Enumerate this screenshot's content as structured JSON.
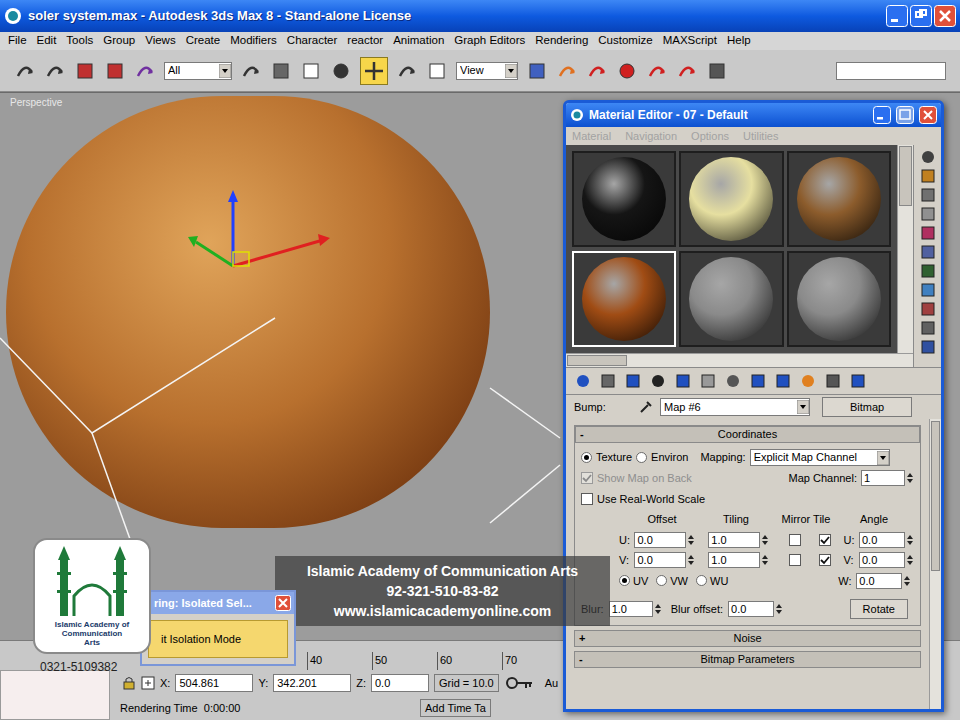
{
  "window": {
    "title": "soler system.max - Autodesk 3ds Max 8 - Stand-alone License"
  },
  "menu": [
    "File",
    "Edit",
    "Tools",
    "Group",
    "Views",
    "Create",
    "Modifiers",
    "Character",
    "reactor",
    "Animation",
    "Graph Editors",
    "Rendering",
    "Customize",
    "MAXScript",
    "Help"
  ],
  "toolbar": {
    "selection_filter": "All",
    "reference_coord": "View"
  },
  "viewport": {
    "label": "Perspective"
  },
  "material_editor": {
    "title": "Material Editor - 07 - Default",
    "menu": [
      {
        "label": "Material",
        "disabled": true
      },
      {
        "label": "Navigation",
        "disabled": true
      },
      {
        "label": "Options",
        "disabled": true
      },
      {
        "label": "Utilities",
        "disabled": true
      }
    ],
    "slots": [
      {
        "selected": false,
        "color": "#151515"
      },
      {
        "selected": false,
        "color": "#e6dfa0"
      },
      {
        "selected": false,
        "color": "#8c5c2c"
      },
      {
        "selected": true,
        "color": "#a04c14"
      },
      {
        "selected": false,
        "color": "#8a8a8a"
      },
      {
        "selected": false,
        "color": "#8a8a8a"
      }
    ],
    "bump": {
      "label": "Bump:",
      "map": "Map #6",
      "type": "Bitmap"
    },
    "coordinates": {
      "title": "Coordinates",
      "toggle": "-",
      "modes": [
        {
          "label": "Texture",
          "selected": true
        },
        {
          "label": "Environ",
          "selected": false
        }
      ],
      "mapping_label": "Mapping:",
      "mapping": "Explicit Map Channel",
      "show_map_on_back": {
        "label": "Show Map on Back",
        "checked": true,
        "disabled": true
      },
      "map_channel_label": "Map Channel:",
      "map_channel": "1",
      "real_world": {
        "label": "Use Real-World Scale",
        "checked": false
      },
      "headers": [
        "Offset",
        "Tiling",
        "Mirror Tile",
        "Angle"
      ],
      "rows": [
        {
          "axis": "U:",
          "offset": "0.0",
          "tiling": "1.0",
          "mirror": false,
          "tile": true,
          "angle_axis": "U:",
          "angle": "0.0"
        },
        {
          "axis": "V:",
          "offset": "0.0",
          "tiling": "1.0",
          "mirror": false,
          "tile": true,
          "angle_axis": "V:",
          "angle": "0.0"
        }
      ],
      "planes": [
        {
          "label": "UV",
          "selected": true
        },
        {
          "label": "VW",
          "selected": false
        },
        {
          "label": "WU",
          "selected": false
        }
      ],
      "w_axis": "W:",
      "w_angle": "0.0",
      "blur_label": "Blur:",
      "blur": "1.0",
      "blur_offset_label": "Blur offset:",
      "blur_offset": "0.0",
      "rotate": "Rotate"
    },
    "rollouts": [
      {
        "title": "Noise",
        "toggle": "+"
      },
      {
        "title": "Bitmap Parameters",
        "toggle": "-"
      }
    ]
  },
  "watermark": [
    "Islamic Academy of Communication Arts",
    "92-321-510-83-82",
    "www.islamicacademyonline.com"
  ],
  "logo": {
    "text": "Islamic Academy of Communication Arts",
    "phone": "0321-5109382"
  },
  "isolation": {
    "title": "ring: Isolated Sel...",
    "button": "it Isolation Mode"
  },
  "timeline": {
    "ticks": [
      "40",
      "50",
      "60",
      "70"
    ]
  },
  "status": {
    "x_label": "X:",
    "x": "504.861",
    "y_label": "Y:",
    "y": "342.201",
    "z_label": "Z:",
    "z": "0.0",
    "grid": "Grid = 10.0",
    "auto": "Au",
    "rendering_time": "Rendering Time  0:00:00",
    "add_time_tag": "Add Time Ta"
  }
}
